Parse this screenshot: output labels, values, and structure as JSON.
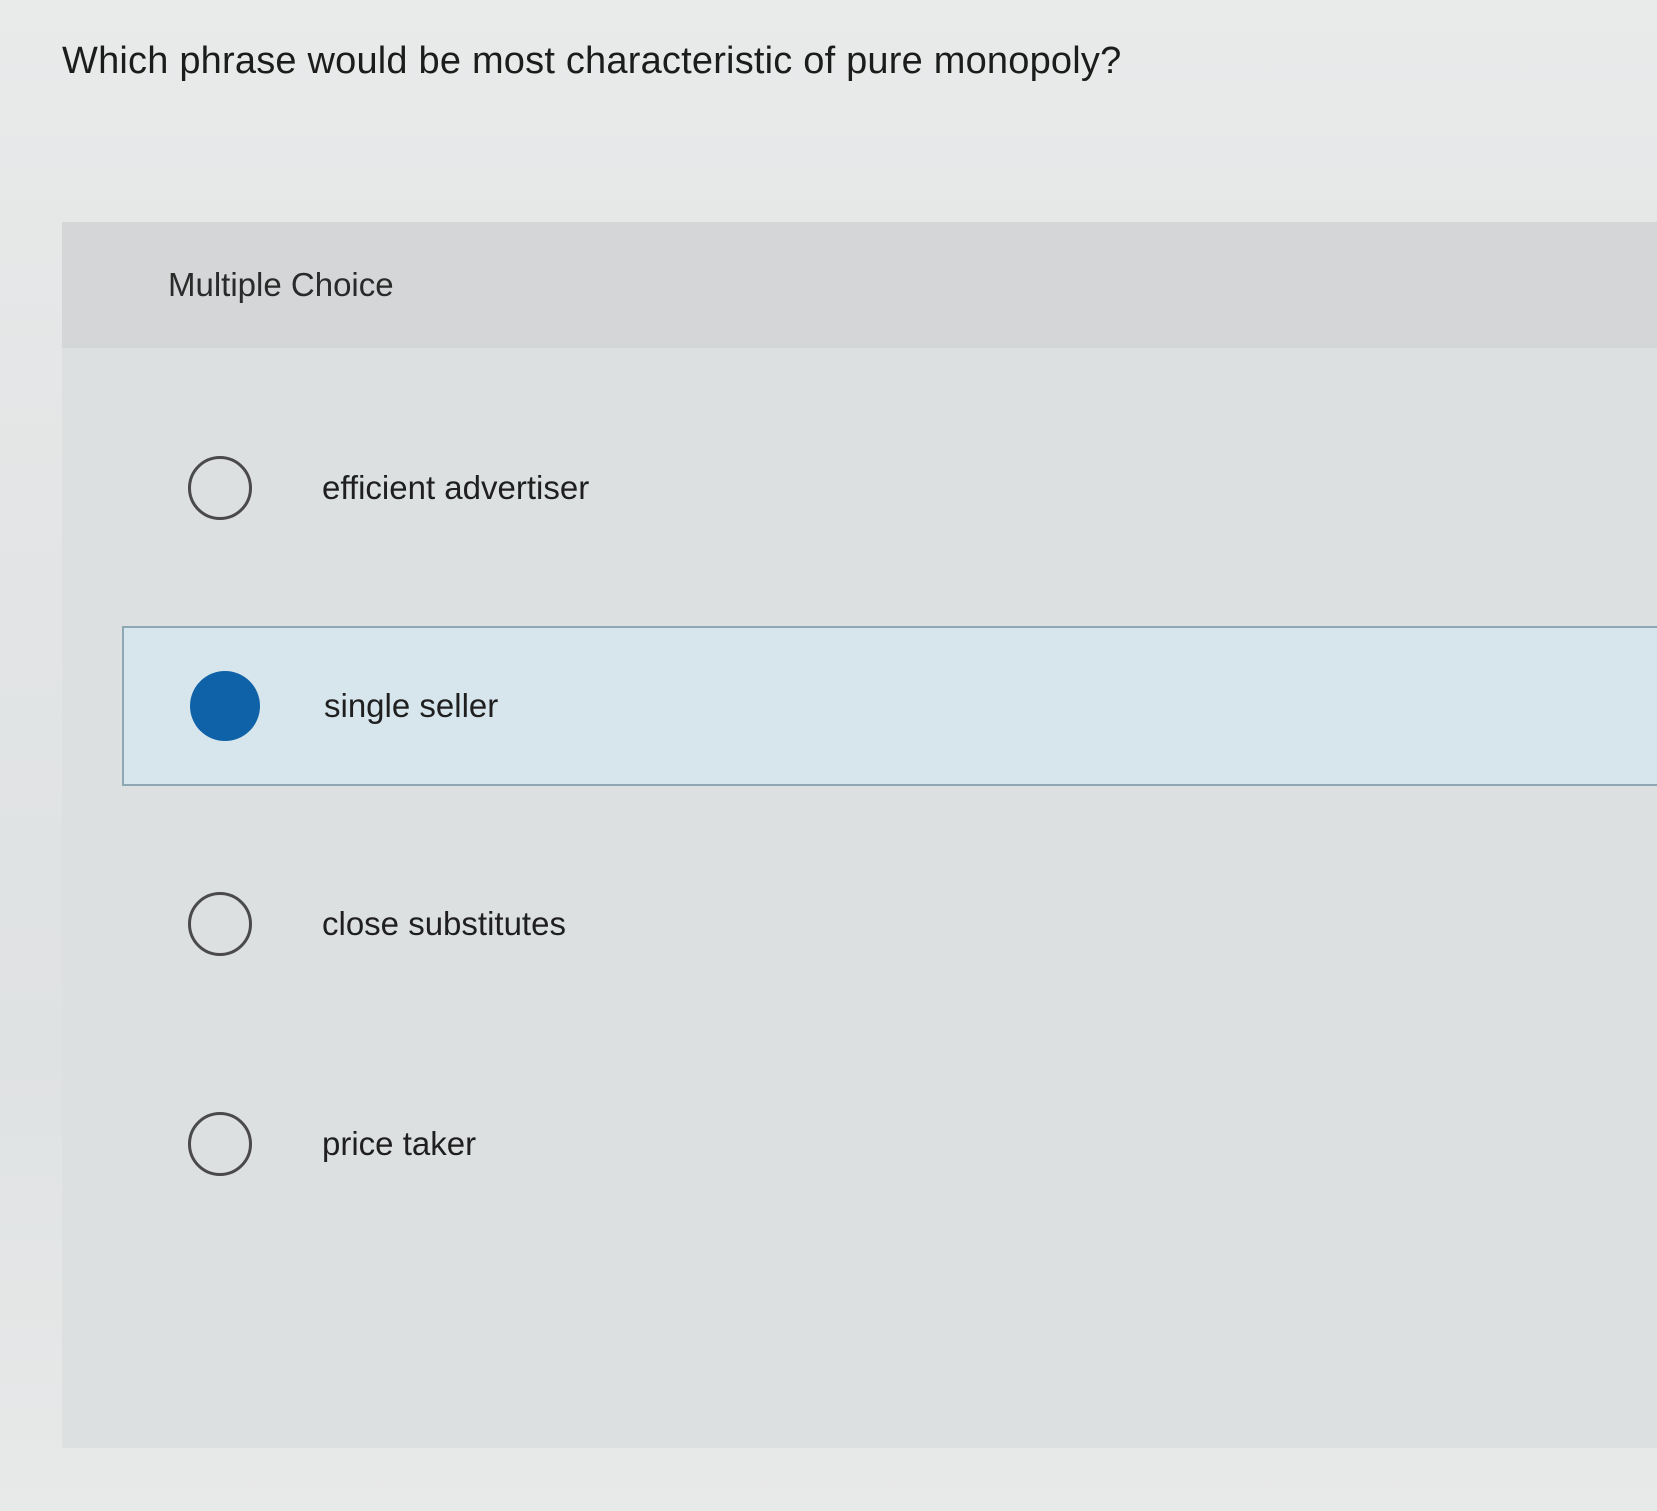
{
  "question": {
    "text": "Which phrase would be most characteristic of pure monopoly?"
  },
  "multiple_choice": {
    "label": "Multiple Choice",
    "selected_index": 1,
    "options": [
      {
        "label": "efficient advertiser",
        "selected": false
      },
      {
        "label": "single seller",
        "selected": true
      },
      {
        "label": "close substitutes",
        "selected": false
      },
      {
        "label": "price taker",
        "selected": false
      }
    ]
  },
  "colors": {
    "selected_radio": "#0f62a8",
    "selected_row_background": "#d7e6ed",
    "selected_row_border": "#8fa6b4"
  }
}
